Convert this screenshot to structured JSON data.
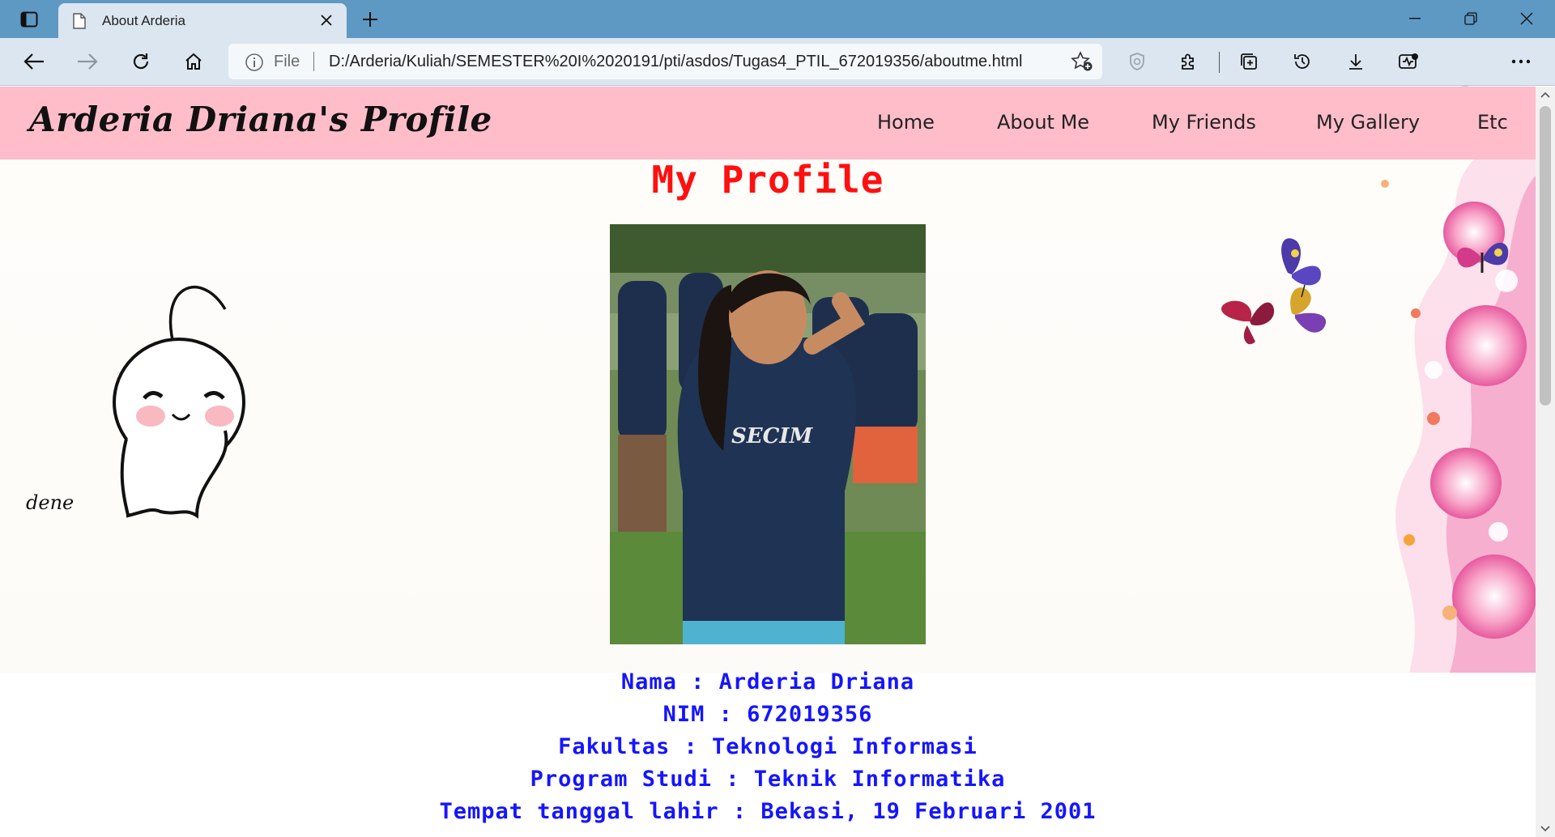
{
  "browser": {
    "tab_title": "About Arderia",
    "address": {
      "scheme_label": "File",
      "url": "D:/Arderia/Kuliah/SEMESTER%20I%2020191/pti/asdos/Tugas4_PTIL_672019356/aboutme.html"
    }
  },
  "page": {
    "brand": "Arderia Driana's Profile",
    "nav": [
      {
        "label": "Home"
      },
      {
        "label": "About Me"
      },
      {
        "label": "My Friends"
      },
      {
        "label": "My Gallery"
      },
      {
        "label": "Etc"
      }
    ],
    "heading": "My Profile",
    "doodle_signature": "dene",
    "details": [
      {
        "text": "Nama : Arderia Driana"
      },
      {
        "text": "NIM : 672019356"
      },
      {
        "text": "Fakultas : Teknologi Informasi"
      },
      {
        "text": "Program Studi : Teknik Informatika"
      },
      {
        "text": "Tempat tanggal lahir : Bekasi, 19 Februari 2001"
      }
    ]
  },
  "colors": {
    "tabbar": "#5e99c3",
    "toolbar": "#dbe6f0",
    "navbar": "#ffbdc9",
    "heading": "#ff0f0f",
    "details": "#1515ff"
  }
}
